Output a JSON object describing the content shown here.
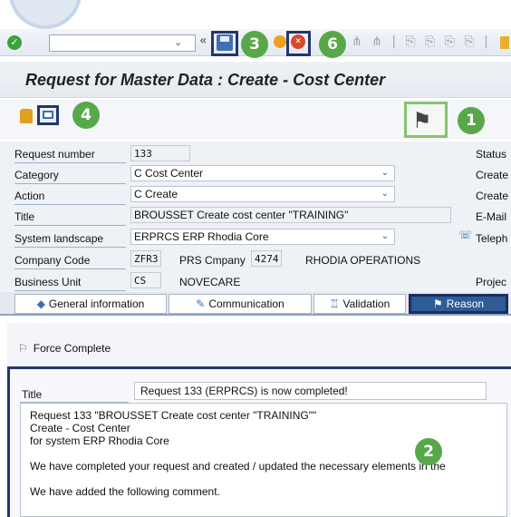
{
  "toolbar": {
    "ok_symbol": "✓",
    "command_field_value": "",
    "dropdown_symbol": "⌄",
    "back_symbol": "«",
    "cancel_symbol": "✕",
    "extra_icons": "⋔ ⋔ | ⎘ ⎘ ⎘ ⎘ |"
  },
  "window": {
    "title": "Request for Master Data : Create - Cost Center"
  },
  "annotations": {
    "n1": "1",
    "n2": "2",
    "n3": "3",
    "n4": "4",
    "n6": "6",
    "accent": "#58a84a",
    "box_color": "#24356e"
  },
  "form": {
    "request_number": {
      "label": "Request number",
      "value": "133"
    },
    "category": {
      "label": "Category",
      "value": "C Cost Center"
    },
    "action": {
      "label": "Action",
      "value": "C Create"
    },
    "title": {
      "label": "Title",
      "value": "BROUSSET Create cost center \"TRAINING\""
    },
    "system_landscape": {
      "label": "System landscape",
      "value": "ERPRCS ERP Rhodia Core"
    },
    "company_code": {
      "label": "Company Code",
      "value": "ZFR3",
      "desc": "PRS Cmpany",
      "code2": "4274",
      "desc2": "RHODIA OPERATIONS"
    },
    "business_unit": {
      "label": "Business Unit",
      "value": "CS",
      "desc": "NOVECARE"
    },
    "right_labels": {
      "status": "Status",
      "created1": "Create",
      "created2": "Create",
      "email": "E-Mail",
      "telephone": "Teleph",
      "project": "Projec"
    }
  },
  "tabs": [
    {
      "label": "General information",
      "icon": "◆"
    },
    {
      "label": "Communication",
      "icon": "✎"
    },
    {
      "label": "Validation",
      "icon": "♖"
    },
    {
      "label": "Reason",
      "icon": "⚑"
    }
  ],
  "reason": {
    "force_complete_icon": "⚐",
    "force_complete_label": "Force Complete",
    "title_label": "Title",
    "title_value": "Request 133 (ERPRCS) is now completed!",
    "body_lines": [
      "Request 133 \"BROUSSET Create cost center \"TRAINING\"\"",
      "Create - Cost Center",
      "for system ERP Rhodia Core",
      "",
      "We have completed your request and created / updated the necessary elements in the",
      "",
      "We have added the following comment."
    ]
  }
}
